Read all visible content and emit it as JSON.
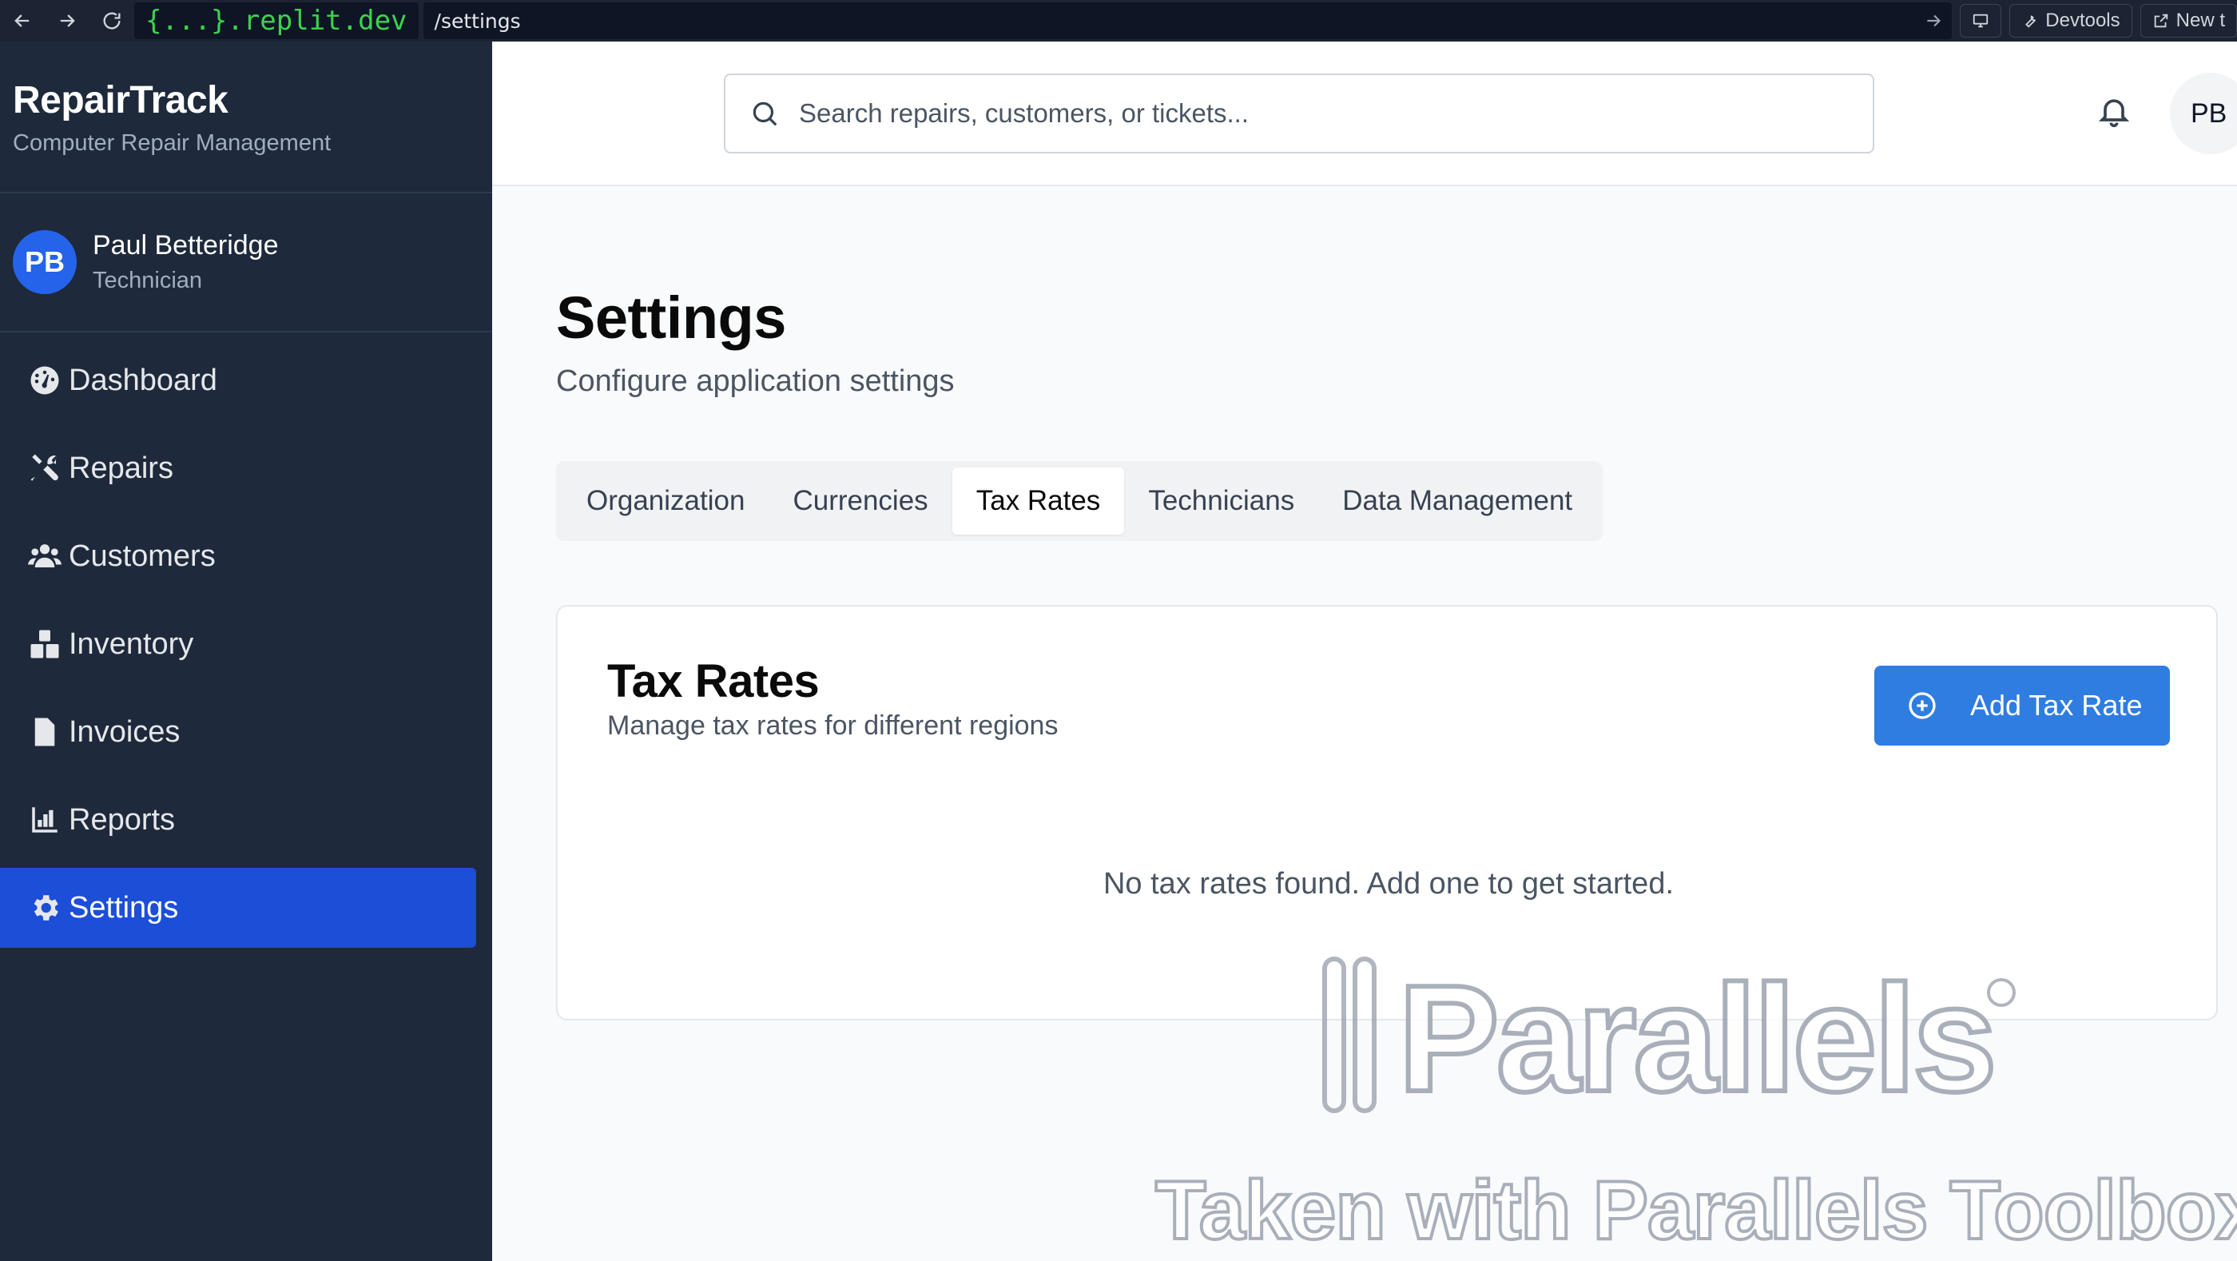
{
  "browser": {
    "host": "{...}.replit.dev",
    "path": "/settings",
    "devtools_label": "Devtools",
    "new_tab_label": "New t"
  },
  "sidebar": {
    "brand_title": "RepairTrack",
    "brand_subtitle": "Computer Repair Management",
    "user": {
      "initials": "PB",
      "name": "Paul Betteridge",
      "role": "Technician"
    },
    "items": [
      {
        "label": "Dashboard",
        "icon": "dashboard-icon"
      },
      {
        "label": "Repairs",
        "icon": "tools-icon"
      },
      {
        "label": "Customers",
        "icon": "users-icon"
      },
      {
        "label": "Inventory",
        "icon": "boxes-icon"
      },
      {
        "label": "Invoices",
        "icon": "invoice-icon"
      },
      {
        "label": "Reports",
        "icon": "chart-icon"
      },
      {
        "label": "Settings",
        "icon": "gear-icon",
        "active": true
      }
    ]
  },
  "header": {
    "search_placeholder": "Search repairs, customers, or tickets...",
    "avatar_initials": "PB"
  },
  "main": {
    "title": "Settings",
    "subtitle": "Configure application settings",
    "tabs": [
      {
        "label": "Organization"
      },
      {
        "label": "Currencies"
      },
      {
        "label": "Tax Rates",
        "active": true
      },
      {
        "label": "Technicians"
      },
      {
        "label": "Data Management"
      }
    ],
    "card": {
      "title": "Tax Rates",
      "subtitle": "Manage tax rates for different regions",
      "add_button": "Add Tax Rate",
      "empty_message": "No tax rates found. Add one to get started."
    }
  },
  "watermark": {
    "logo_text": "Parallels",
    "caption": "Taken with Parallels Toolbox"
  },
  "colors": {
    "sidebar_bg": "#1e293b",
    "active_nav": "#1d4ed8",
    "primary_button": "#2f7de1"
  }
}
